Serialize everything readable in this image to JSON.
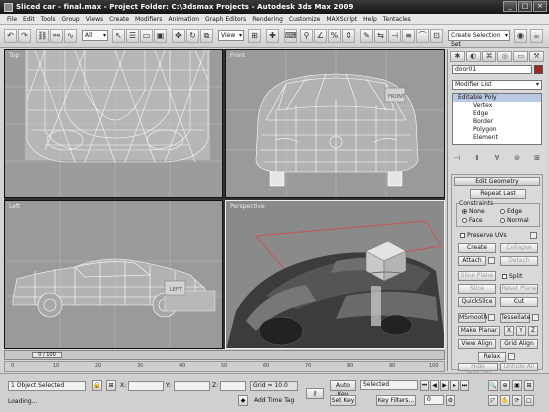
{
  "window": {
    "title": "Sliced car - final.max    - Project Folder: C:\\3dsmax Projects    - Autodesk 3ds Max  2009",
    "buttons": [
      "_",
      "□",
      "×"
    ]
  },
  "menu": [
    "File",
    "Edit",
    "Tools",
    "Group",
    "Views",
    "Create",
    "Modifiers",
    "Animation",
    "Graph Editors",
    "Rendering",
    "Customize",
    "MAXScript",
    "Help",
    "Tentacles"
  ],
  "toolbar": {
    "selection_filter": "All",
    "ref_coord": "View",
    "named_selection": "Create Selection Set"
  },
  "viewports": {
    "top": "Top",
    "front": "Front",
    "left": "Left",
    "perspective": "Perspective",
    "viewcube_front": "FRONT",
    "viewcube_left": "LEFT"
  },
  "timeline": {
    "frame": "0 / 100",
    "ticks": [
      "0",
      "10",
      "20",
      "30",
      "40",
      "50",
      "60",
      "70",
      "80",
      "90",
      "100"
    ]
  },
  "status": {
    "selected": "1 Object Selected",
    "prompt": "Loading...",
    "x_label": "X:",
    "y_label": "Y:",
    "z_label": "Z:",
    "x_value": "",
    "y_value": "",
    "z_value": "",
    "grid": "Grid = 10.0",
    "add_time_tag": "Add Time Tag",
    "auto_key": "Auto Key",
    "set_key": "Set Key",
    "key_mode": "Selected",
    "key_filters": "Key Filters...",
    "frame_value": "0"
  },
  "command_panel": {
    "object_name": "door01",
    "modifier_list": "Modifier List",
    "stack": [
      "Editable Poly",
      "Vertex",
      "Edge",
      "Border",
      "Polygon",
      "Element"
    ],
    "rollout_title": "Edit Geometry",
    "repeat_last": "Repeat Last",
    "constraints_label": "Constraints",
    "constraint_none": "None",
    "constraint_edge": "Edge",
    "constraint_face": "Face",
    "constraint_normal": "Normal",
    "preserve_uvs": "Preserve UVs",
    "create": "Create",
    "collapse": "Collapse",
    "attach": "Attach",
    "detach": "Detach",
    "slice_plane": "Slice Plane",
    "split": "Split",
    "slice": "Slice",
    "reset_plane": "Reset Plane",
    "quickslice": "QuickSlice",
    "cut": "Cut",
    "msmooth": "MSmooth",
    "tessellate": "Tessellate",
    "make_planar": "Make Planar",
    "make_planar_x": "X",
    "make_planar_y": "Y",
    "make_planar_z": "Z",
    "view_align": "View Align",
    "grid_align": "Grid Align",
    "relax": "Relax",
    "hide_selected": "Hide Selected",
    "unhide_all": "Unhide All"
  }
}
